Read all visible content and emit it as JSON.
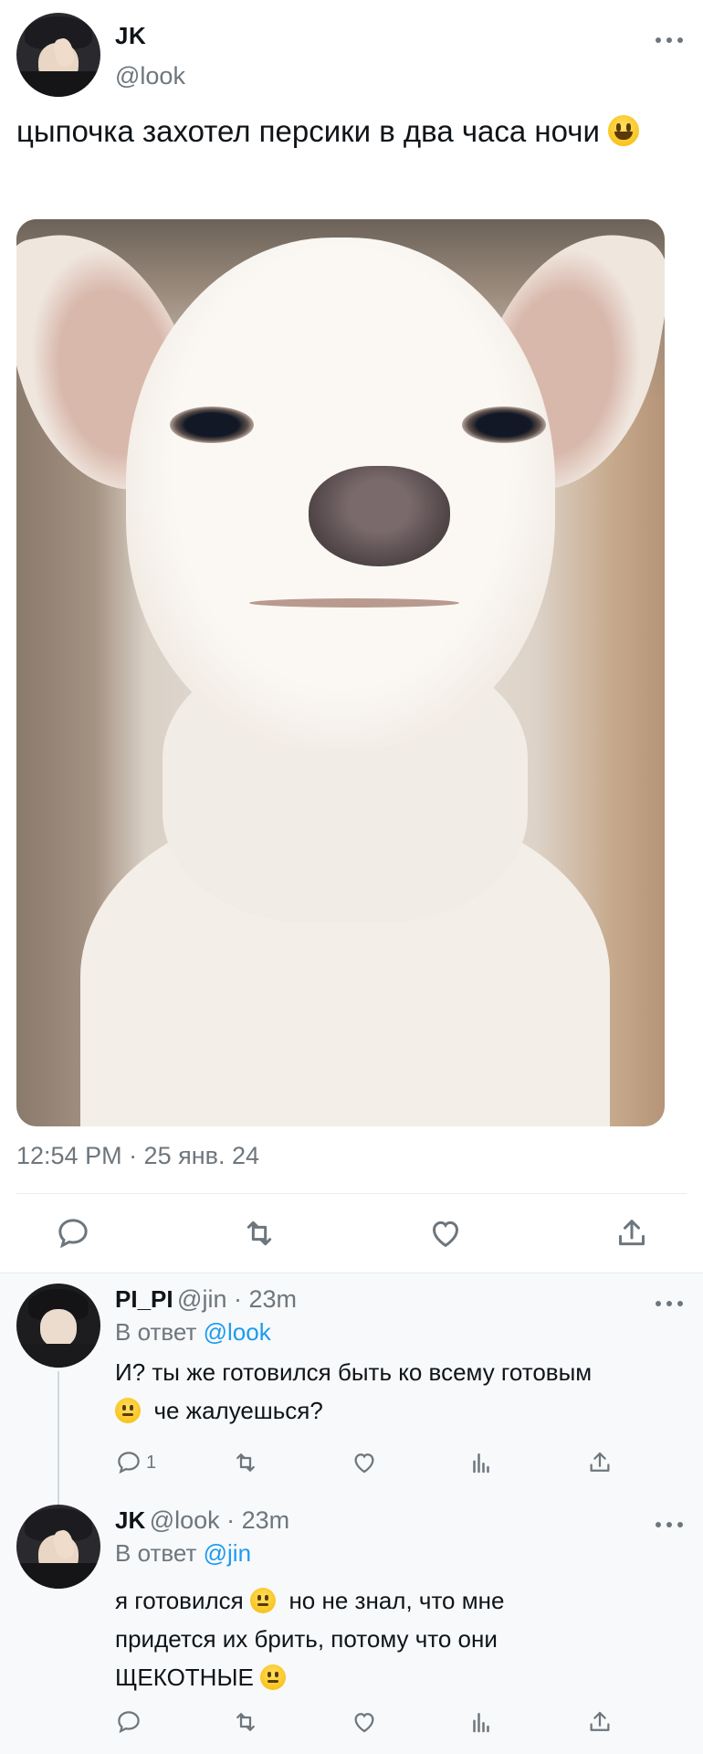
{
  "tweet": {
    "author_name": "JK",
    "author_handle": "@look",
    "text": "цыпочка захотел персики в два часа ночи",
    "timestamp": "12:54 PM · 25 янв. 24",
    "photo_icon": "chihuahua-photo",
    "actions": [
      "reply-icon",
      "retweet-icon",
      "like-icon",
      "share-icon"
    ]
  },
  "replies": [
    {
      "author_name": "PI_PI",
      "meta": "@jin · 23m",
      "reply_prefix": "В ответ",
      "reply_to": "@look",
      "text_line1": "И? ты же готовился быть ко всему готовым",
      "text_line2": "че жалуешься?",
      "reply_count": "1"
    },
    {
      "author_name": "JK",
      "meta": "@look · 23m",
      "reply_prefix": "В ответ",
      "reply_to": "@jin",
      "text_line1a": "я готовился",
      "text_line1b": "но не знал, что мне",
      "text_line2": "придется их брить, потому что они",
      "text_line3": "ЩЕКОТНЫЕ"
    }
  ],
  "colors": {
    "link": "#1d9bf0",
    "secondary_text": "#6e767d",
    "reply_background": "#f7f9fa",
    "divider": "#e6ecf0"
  }
}
